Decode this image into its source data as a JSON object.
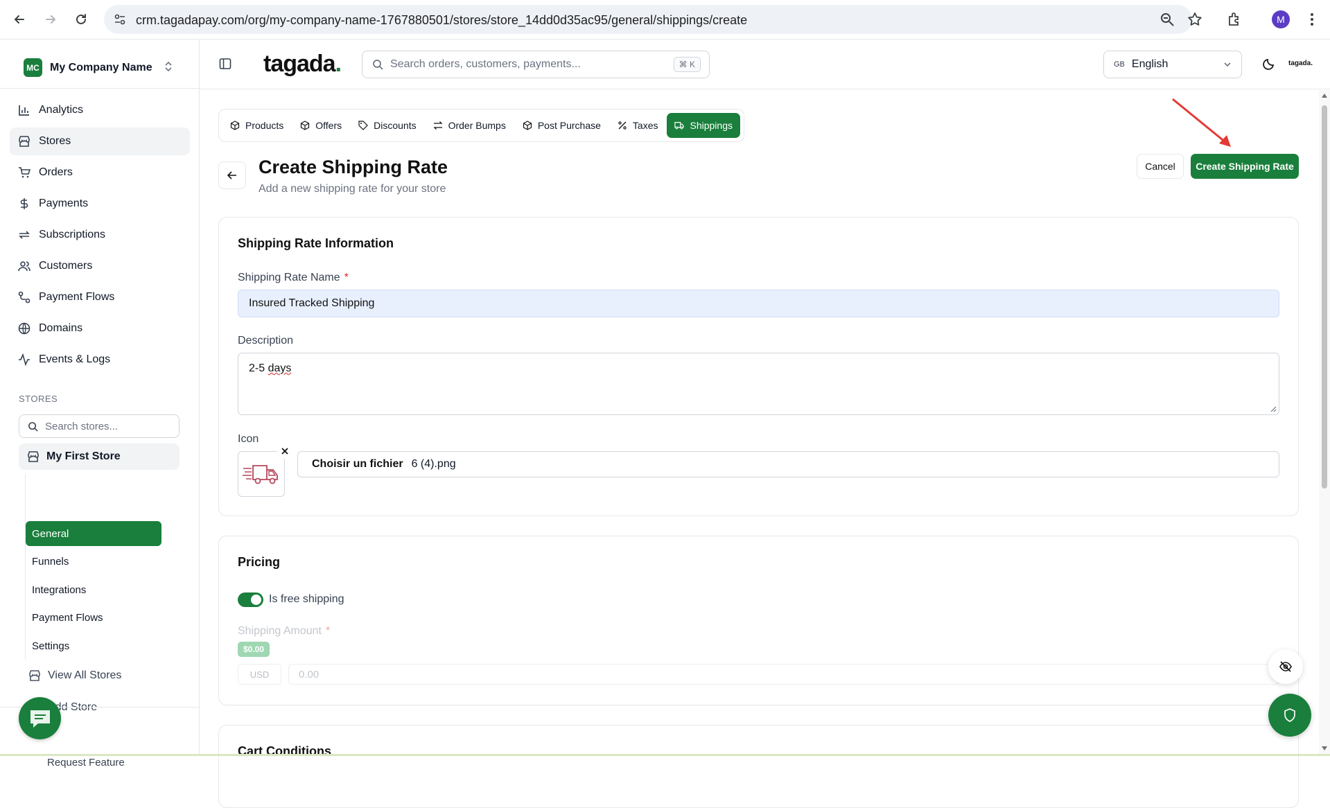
{
  "browser": {
    "url": "crm.tagadapay.com/org/my-company-name-1767880501/stores/store_14dd0d35ac95/general/shippings/create",
    "profile_initial": "M"
  },
  "sidebar": {
    "company_initials": "MC",
    "company_name": "My Company Name",
    "nav": [
      {
        "label": "Analytics",
        "icon": "chart-icon"
      },
      {
        "label": "Stores",
        "icon": "store-icon"
      },
      {
        "label": "Orders",
        "icon": "cart-icon"
      },
      {
        "label": "Payments",
        "icon": "dollar-icon"
      },
      {
        "label": "Subscriptions",
        "icon": "repeat-icon"
      },
      {
        "label": "Customers",
        "icon": "users-icon"
      },
      {
        "label": "Payment Flows",
        "icon": "flow-icon"
      },
      {
        "label": "Domains",
        "icon": "globe-icon"
      },
      {
        "label": "Events & Logs",
        "icon": "activity-icon"
      }
    ],
    "stores_section_label": "STORES",
    "store_search_placeholder": "Search stores...",
    "current_store": "My First Store",
    "store_sub": [
      "General",
      "Funnels",
      "Integrations",
      "Payment Flows",
      "Settings"
    ],
    "view_all_stores": "View All Stores",
    "add_store": "Add Store",
    "request_feature": "Request Feature"
  },
  "topbar": {
    "brand": "tagada",
    "brand_dot": ".",
    "search_placeholder": "Search orders, customers, payments...",
    "search_shortcut": "⌘ K",
    "language_code": "GB",
    "language": "English",
    "mini_brand": "tagada."
  },
  "tabs": [
    {
      "label": "Products",
      "icon": "box-icon"
    },
    {
      "label": "Offers",
      "icon": "box-icon"
    },
    {
      "label": "Discounts",
      "icon": "tag-icon"
    },
    {
      "label": "Order Bumps",
      "icon": "swap-icon"
    },
    {
      "label": "Post Purchase",
      "icon": "box-icon"
    },
    {
      "label": "Taxes",
      "icon": "percent-icon"
    },
    {
      "label": "Shippings",
      "icon": "truck-icon",
      "active": true
    }
  ],
  "page": {
    "title": "Create Shipping Rate",
    "subtitle": "Add a new shipping rate for your store",
    "cancel_label": "Cancel",
    "create_label": "Create Shipping Rate"
  },
  "info_card": {
    "title": "Shipping Rate Information",
    "name_label": "Shipping Rate Name",
    "required_mark": "*",
    "name_value": "Insured Tracked Shipping",
    "description_label": "Description",
    "description_value_prefix": "2-5 ",
    "description_value_spell": "days",
    "icon_label": "Icon",
    "file_button": "Choisir un fichier",
    "file_name": "6 (4).png"
  },
  "pricing_card": {
    "title": "Pricing",
    "free_shipping_label": "Is free shipping",
    "free_shipping_on": true,
    "amount_label": "Shipping Amount",
    "required_mark": "*",
    "amount_badge": "$0.00",
    "currency": "USD",
    "amount_placeholder": "0.00"
  },
  "cart_card": {
    "title": "Cart Conditions"
  },
  "colors": {
    "accent": "#1a7f3c",
    "annotation_arrow": "#e53935"
  }
}
